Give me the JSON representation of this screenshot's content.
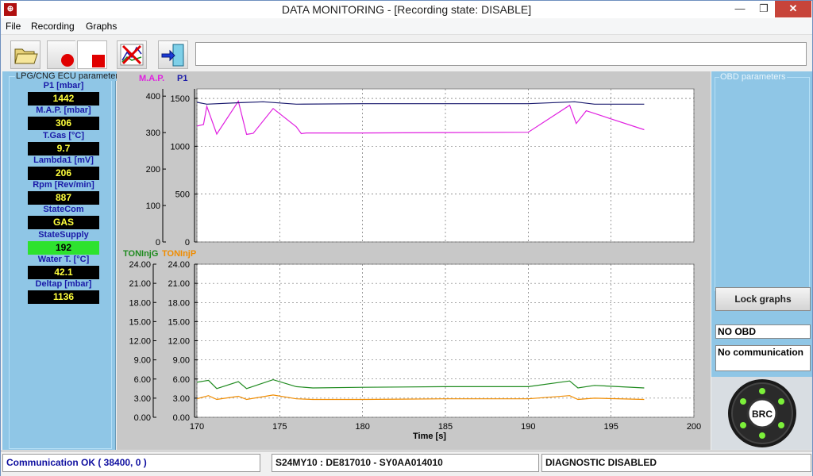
{
  "window": {
    "title": "DATA MONITORING - [Recording state: DISABLE]",
    "close_glyph": "✕",
    "min_glyph": "—",
    "max_glyph": "❐"
  },
  "menu": [
    "File",
    "Recording",
    "Graphs"
  ],
  "toolbar": {
    "buttons": [
      "open-folder",
      "record-start",
      "record-stop",
      "clear-graph",
      "exit"
    ],
    "status_text": ""
  },
  "ecu_panel": {
    "title": "LPG/CNG ECU parameters",
    "params": [
      {
        "label": "P1 [mbar]",
        "value": "1442"
      },
      {
        "label": "M.A.P. [mbar]",
        "value": "306"
      },
      {
        "label": "T.Gas [°C]",
        "value": "9.7"
      },
      {
        "label": "Lambda1 [mV]",
        "value": "206"
      },
      {
        "label": "Rpm [Rev/min]",
        "value": "887"
      },
      {
        "label": "StateCom",
        "value": "GAS"
      },
      {
        "label": "StateSupply",
        "value": "192"
      },
      {
        "label": "Water T. [°C]",
        "value": "42.1"
      },
      {
        "label": "Deltap [mbar]",
        "value": "1136"
      }
    ]
  },
  "obd_panel": {
    "title": "OBD parameters",
    "lock_button": "Lock graphs",
    "obd_status": "NO OBD",
    "comm_status": "No communication",
    "logo_text": "BRC"
  },
  "status_bar": {
    "communication": "Communication OK ( 38400,  0 )",
    "ecu_id": "S24MY10 : DE817010 - SY0AA014010",
    "diagnostic": "DIAGNOSTIC DISABLED"
  },
  "chart_data": [
    {
      "type": "line",
      "xlabel": "",
      "xlim": [
        170,
        200
      ],
      "x_ticks": [],
      "left_axis": {
        "label": "M.A.P.",
        "color": "#e020e0",
        "ylim": [
          0,
          420
        ],
        "ticks": [
          "0",
          "100",
          "200",
          "300",
          "400"
        ]
      },
      "right_axis": {
        "label": "P1",
        "color": "#1a1aa8",
        "ylim": [
          0,
          1600
        ],
        "ticks": [
          "0",
          "500",
          "1000",
          "1500"
        ]
      },
      "series": [
        {
          "name": "M.A.P.",
          "axis": "left",
          "color": "#e020e0",
          "x": [
            170.0,
            170.4,
            170.6,
            171.2,
            172.5,
            173.0,
            173.4,
            174.6,
            176.0,
            176.3,
            176.6,
            180.0,
            185.0,
            190.0,
            192.5,
            192.9,
            193.5,
            197.0
          ],
          "y": [
            318,
            322,
            372,
            296,
            386,
            295,
            298,
            366,
            316,
            297,
            299,
            299,
            300,
            301,
            375,
            325,
            360,
            308
          ]
        },
        {
          "name": "P1",
          "axis": "right",
          "series_axis": "right",
          "color": "#1a1a6e",
          "x": [
            170.0,
            170.6,
            172.5,
            174.0,
            176.0,
            180.0,
            190.0,
            192.8,
            194.0,
            197.0
          ],
          "y": [
            1460,
            1440,
            1455,
            1465,
            1440,
            1445,
            1445,
            1465,
            1440,
            1440
          ]
        }
      ]
    },
    {
      "type": "line",
      "xlabel": "Time [s]",
      "xlim": [
        170,
        200
      ],
      "x_ticks": [
        "170",
        "175",
        "180",
        "185",
        "190",
        "195",
        "200"
      ],
      "left_axis": {
        "label": "TONInjG",
        "color": "#1e8a1e",
        "ylim": [
          0,
          24
        ],
        "ticks": [
          "0.00",
          "3.00",
          "6.00",
          "9.00",
          "12.00",
          "15.00",
          "18.00",
          "21.00",
          "24.00"
        ]
      },
      "right_axis": {
        "label": "TONInjP",
        "color": "#f08c00",
        "ylim": [
          0,
          24
        ],
        "ticks": [
          "0.00",
          "3.00",
          "6.00",
          "9.00",
          "12.00",
          "15.00",
          "18.00",
          "21.00",
          "24.00"
        ]
      },
      "series": [
        {
          "name": "TONInjG",
          "axis": "left",
          "color": "#1e8a1e",
          "x": [
            170.0,
            170.7,
            171.2,
            172.5,
            173.0,
            174.6,
            176.0,
            177.0,
            180.0,
            185.0,
            190.0,
            192.5,
            193.0,
            194.0,
            197.0
          ],
          "y": [
            5.5,
            5.8,
            4.5,
            5.6,
            4.5,
            5.9,
            4.8,
            4.6,
            4.7,
            4.8,
            4.8,
            5.7,
            4.6,
            5.0,
            4.6
          ]
        },
        {
          "name": "TONInjP",
          "axis": "right",
          "color": "#f08c00",
          "x": [
            170.0,
            170.7,
            171.2,
            172.5,
            173.0,
            174.6,
            176.0,
            177.0,
            180.0,
            185.0,
            190.0,
            192.5,
            193.0,
            194.0,
            197.0
          ],
          "y": [
            2.9,
            3.4,
            2.8,
            3.3,
            2.8,
            3.5,
            2.9,
            2.8,
            2.8,
            2.9,
            2.9,
            3.4,
            2.8,
            3.0,
            2.8
          ]
        }
      ]
    }
  ]
}
